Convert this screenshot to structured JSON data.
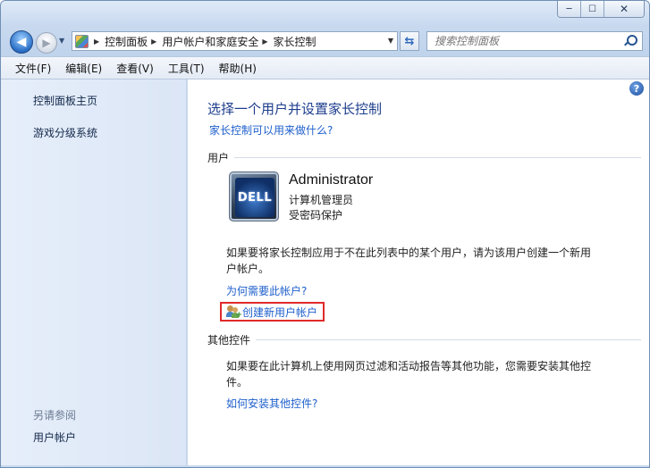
{
  "window": {
    "caption_minimize": "─",
    "caption_maximize": "☐",
    "caption_close": "✕"
  },
  "nav": {
    "back_glyph": "◀",
    "forward_glyph": "▶",
    "breadcrumbs": [
      "控制面板",
      "用户帐户和家庭安全",
      "家长控制"
    ],
    "search_placeholder": "搜索控制面板"
  },
  "menu": [
    "文件(F)",
    "编辑(E)",
    "查看(V)",
    "工具(T)",
    "帮助(H)"
  ],
  "sidebar": {
    "links": [
      "控制面板主页",
      "游戏分级系统"
    ],
    "see_also": "另请参阅",
    "see_also_links": [
      "用户帐户"
    ]
  },
  "main": {
    "title": "选择一个用户并设置家长控制",
    "what_can_do_link": "家长控制可以用来做什么?",
    "users_section": "用户",
    "user": {
      "avatar_text": "DELL",
      "name": "Administrator",
      "role": "计算机管理员",
      "password": "受密码保护"
    },
    "create_para": "如果要将家长控制应用于不在此列表中的某个用户，请为该用户创建一个新用户帐户。",
    "why_link": "为何需要此帐户?",
    "create_link": "创建新用户帐户",
    "other_section": "其他控件",
    "other_para": "如果要在此计算机上使用网页过滤和活动报告等其他功能，您需要安装其他控件。",
    "install_link": "如何安装其他控件?",
    "help_glyph": "?"
  },
  "colors": {
    "link": "#1e5fcc",
    "title": "#1d3d8d",
    "highlight_border": "#e02a2a",
    "sidebar_bg": "#dbe6f6"
  }
}
